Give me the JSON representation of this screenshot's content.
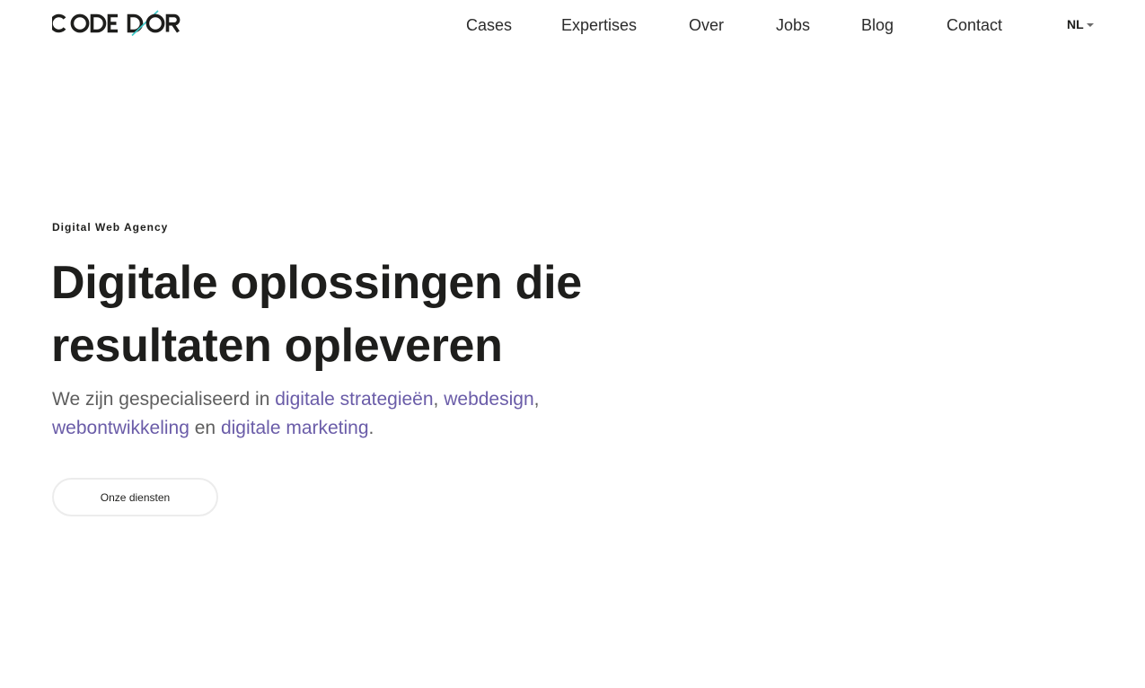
{
  "header": {
    "logo_text": "CODE D'OR",
    "nav": [
      {
        "label": "Cases"
      },
      {
        "label": "Expertises"
      },
      {
        "label": "Over"
      },
      {
        "label": "Jobs"
      },
      {
        "label": "Blog"
      },
      {
        "label": "Contact"
      }
    ],
    "language": "NL"
  },
  "hero": {
    "eyebrow": "Digital Web Agency",
    "headline": "Digitale oplossingen die resultaten opleveren",
    "intro": {
      "prefix": "We zijn gespecialiseerd in ",
      "link1": "digitale strategieën",
      "sep1": ", ",
      "link2": "webdesign",
      "sep2": ",",
      "link3": "webontwikkeling",
      "sep3": " en ",
      "link4": "digitale marketing",
      "suffix": "."
    },
    "cta_label": "Onze diensten"
  },
  "colors": {
    "text": "#1e1e1c",
    "muted_text": "#5e5e5e",
    "link": "#6a5ca8",
    "logo_accent": "#3cc9c9",
    "button_border": "#ececec"
  }
}
